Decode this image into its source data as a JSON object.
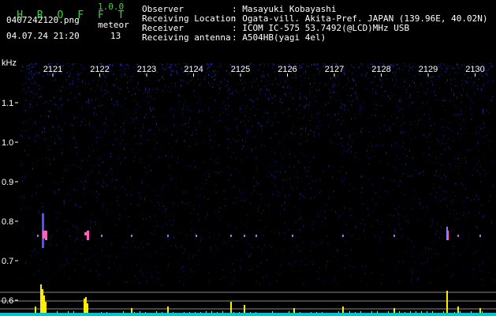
{
  "app": {
    "title": "H R O F F T",
    "version": "1.0.0"
  },
  "file": {
    "name": "0407242120.png",
    "datetime": "04.07.24 21:20"
  },
  "meteor": {
    "label": "meteor",
    "count": "13"
  },
  "info": [
    {
      "label": "Observer",
      "value": ": Masayuki Kobayashi"
    },
    {
      "label": "Receiving Location",
      "value": ": Ogata-vill. Akita-Pref. JAPAN (139.96E, 40.02N)"
    },
    {
      "label": "Receiver",
      "value": ": ICOM IC-575 53.7492(@LCD)MHz USB"
    },
    {
      "label": "Receiving antenna",
      "value": ": A504HB(yagi 4el)"
    }
  ],
  "axis": {
    "unit": "kHz",
    "time_ticks": [
      "2121",
      "2122",
      "2123",
      "2124",
      "2125",
      "2126",
      "2127",
      "2128",
      "2129",
      "2130"
    ],
    "freq_ticks": [
      "1.1",
      "1.0",
      "0.9",
      "0.8",
      "0.7",
      "0.6"
    ]
  },
  "colors": {
    "background": "#000000",
    "title": "#3cd23c",
    "text": "#ffffff",
    "noise": "#2a2a8a",
    "echo": "#ff60c0",
    "power": "#ffee00",
    "baseline": "#00c8c8"
  }
}
